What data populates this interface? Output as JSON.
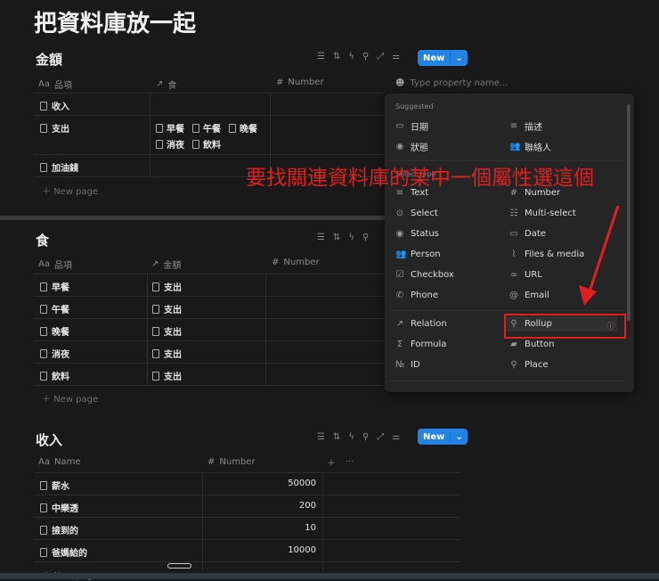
{
  "page_title": "把資料庫放一起",
  "toolbar": {
    "new_label": "New"
  },
  "db_amount": {
    "title": "金額",
    "columns": [
      "品項",
      "食",
      "Number"
    ],
    "rows": [
      {
        "name": "收入",
        "food": []
      },
      {
        "name": "支出",
        "food": [
          "早餐",
          "午餐",
          "晚餐",
          "消夜",
          "飲料"
        ]
      },
      {
        "name": "加油錢",
        "food": []
      }
    ],
    "new_page": "New page"
  },
  "db_food": {
    "title": "食",
    "columns": [
      "品項",
      "金額",
      "Number"
    ],
    "rows": [
      {
        "name": "早餐",
        "amount": "支出"
      },
      {
        "name": "午餐",
        "amount": "支出"
      },
      {
        "name": "晚餐",
        "amount": "支出"
      },
      {
        "name": "消夜",
        "amount": "支出"
      },
      {
        "name": "飲料",
        "amount": "支出"
      }
    ],
    "new_page": "New page"
  },
  "db_income": {
    "title": "收入",
    "columns": [
      "Name",
      "Number"
    ],
    "rows": [
      {
        "name": "薪水",
        "number": "50000"
      },
      {
        "name": "中樂透",
        "number": "200"
      },
      {
        "name": "撿到的",
        "number": "10"
      },
      {
        "name": "爸媽給的",
        "number": "10000"
      }
    ],
    "new_page": "New page"
  },
  "property_menu": {
    "placeholder": "Type property name...",
    "suggested_label": "Suggested",
    "suggested": [
      {
        "label": "日期",
        "icon": "calendar-icon"
      },
      {
        "label": "描述",
        "icon": "text-icon"
      },
      {
        "label": "狀態",
        "icon": "status-icon"
      },
      {
        "label": "聯絡人",
        "icon": "person-icon"
      }
    ],
    "select_type_label": "Select type",
    "types": [
      {
        "label": "Text",
        "icon": "text-icon"
      },
      {
        "label": "Number",
        "icon": "hash-icon"
      },
      {
        "label": "Select",
        "icon": "select-icon"
      },
      {
        "label": "Multi-select",
        "icon": "list-icon"
      },
      {
        "label": "Status",
        "icon": "status-icon"
      },
      {
        "label": "Date",
        "icon": "calendar-icon"
      },
      {
        "label": "Person",
        "icon": "person-icon"
      },
      {
        "label": "Files & media",
        "icon": "paperclip-icon"
      },
      {
        "label": "Checkbox",
        "icon": "checkbox-icon"
      },
      {
        "label": "URL",
        "icon": "link-icon"
      },
      {
        "label": "Phone",
        "icon": "phone-icon"
      },
      {
        "label": "Email",
        "icon": "at-icon"
      }
    ],
    "advanced": [
      {
        "label": "Relation",
        "icon": "arrow-icon"
      },
      {
        "label": "Rollup",
        "icon": "search-icon"
      },
      {
        "label": "Formula",
        "icon": "sigma-icon"
      },
      {
        "label": "Button",
        "icon": "button-icon"
      },
      {
        "label": "ID",
        "icon": "numero-icon"
      },
      {
        "label": "Place",
        "icon": "pin-icon"
      }
    ]
  },
  "annotation": {
    "text": "要找關連資料庫的某中一個屬性選這個",
    "color": "#e02020"
  },
  "colors": {
    "accent": "#2383e2",
    "background": "#191919"
  }
}
